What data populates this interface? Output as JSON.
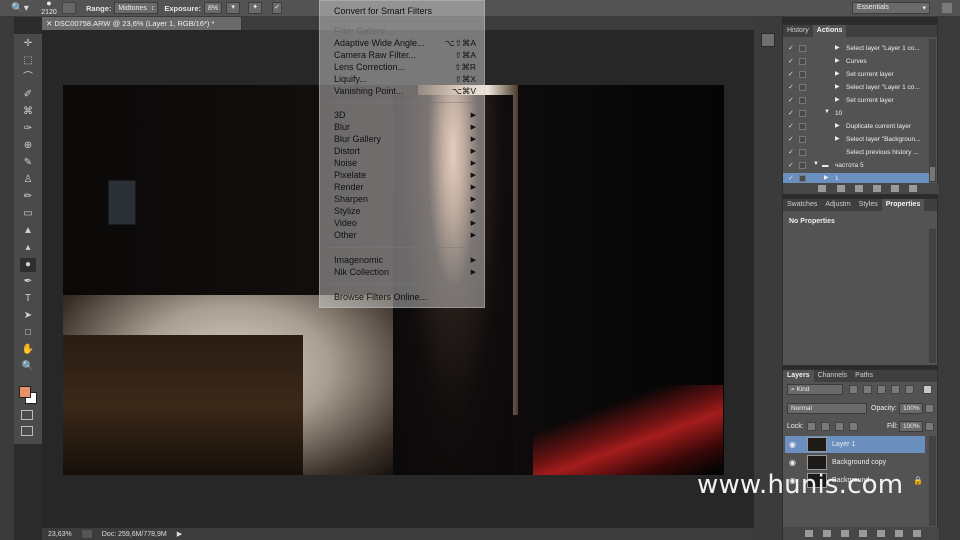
{
  "options_bar": {
    "brush_size": "2120",
    "range_label": "Range:",
    "range_value": "Midtones",
    "exposure_label": "Exposure:",
    "exposure_value": "8%",
    "workspace": "Essentials"
  },
  "document": {
    "tab_title": "DSC00758.ARW @ 23,6% (Layer 1, RGB/16*) *",
    "zoom": "23,63%",
    "doc_size": "Doc: 259,6M/778,9M"
  },
  "filter_menu": {
    "items": [
      {
        "label": "Convert for Smart Filters",
        "shortcut": "",
        "submenu": false,
        "disabled": false
      },
      {
        "label": "Filter Gallery...",
        "shortcut": "",
        "submenu": false,
        "disabled": true
      },
      {
        "label": "Adaptive Wide Angle...",
        "shortcut": "⌥⇧⌘A",
        "submenu": false,
        "disabled": false
      },
      {
        "label": "Camera Raw Filter...",
        "shortcut": "⇧⌘A",
        "submenu": false,
        "disabled": false
      },
      {
        "label": "Lens Correction...",
        "shortcut": "⇧⌘R",
        "submenu": false,
        "disabled": false
      },
      {
        "label": "Liquify...",
        "shortcut": "⇧⌘X",
        "submenu": false,
        "disabled": false
      },
      {
        "label": "Vanishing Point...",
        "shortcut": "⌥⌘V",
        "submenu": false,
        "disabled": false
      },
      {
        "label": "3D",
        "shortcut": "",
        "submenu": true,
        "disabled": false
      },
      {
        "label": "Blur",
        "shortcut": "",
        "submenu": true,
        "disabled": false
      },
      {
        "label": "Blur Gallery",
        "shortcut": "",
        "submenu": true,
        "disabled": false
      },
      {
        "label": "Distort",
        "shortcut": "",
        "submenu": true,
        "disabled": false
      },
      {
        "label": "Noise",
        "shortcut": "",
        "submenu": true,
        "disabled": false
      },
      {
        "label": "Pixelate",
        "shortcut": "",
        "submenu": true,
        "disabled": false
      },
      {
        "label": "Render",
        "shortcut": "",
        "submenu": true,
        "disabled": false
      },
      {
        "label": "Sharpen",
        "shortcut": "",
        "submenu": true,
        "disabled": false
      },
      {
        "label": "Stylize",
        "shortcut": "",
        "submenu": true,
        "disabled": false
      },
      {
        "label": "Video",
        "shortcut": "",
        "submenu": true,
        "disabled": false
      },
      {
        "label": "Other",
        "shortcut": "",
        "submenu": true,
        "disabled": false
      },
      {
        "label": "Imagenomic",
        "shortcut": "",
        "submenu": true,
        "disabled": false
      },
      {
        "label": "Nik Collection",
        "shortcut": "",
        "submenu": true,
        "disabled": false
      },
      {
        "label": "Browse Filters Online...",
        "shortcut": "",
        "submenu": false,
        "disabled": false
      }
    ]
  },
  "history_panel": {
    "tabs": [
      "History",
      "Actions"
    ],
    "active_tab": "Actions",
    "rows": [
      {
        "text": "Select layer \"Layer 1 co...",
        "level": 2
      },
      {
        "text": "Curves",
        "level": 2
      },
      {
        "text": "Set current layer",
        "level": 2
      },
      {
        "text": "Select layer \"Layer 1 co...",
        "level": 2
      },
      {
        "text": "Set current layer",
        "level": 2
      },
      {
        "text": "10",
        "level": 1
      },
      {
        "text": "Duplicate current layer",
        "level": 2
      },
      {
        "text": "Select layer \"Backgroun...",
        "level": 2
      },
      {
        "text": "Select previous history ...",
        "level": 2
      },
      {
        "text": "частота 5",
        "level": 0
      },
      {
        "text": "1",
        "level": 1
      }
    ]
  },
  "properties_panel": {
    "tabs": [
      "Swatches",
      "Adjustm",
      "Styles",
      "Properties"
    ],
    "active_tab": "Properties",
    "title": "No Properties"
  },
  "layers_panel": {
    "tabs": [
      "Layers",
      "Channels",
      "Paths"
    ],
    "active_tab": "Layers",
    "kind_filter": "Kind",
    "blend_mode": "Normal",
    "opacity_label": "Opacity:",
    "opacity": "100%",
    "lock_label": "Lock:",
    "fill_label": "Fill:",
    "fill": "100%",
    "layers": [
      {
        "name": "Layer 1",
        "selected": true
      },
      {
        "name": "Background copy",
        "selected": false
      },
      {
        "name": "Background",
        "selected": false
      }
    ]
  },
  "watermark": "www.hunis.com",
  "colors": {
    "foreground": "#e6936c",
    "background": "#ffffff",
    "selection": "#6b8fbf"
  }
}
